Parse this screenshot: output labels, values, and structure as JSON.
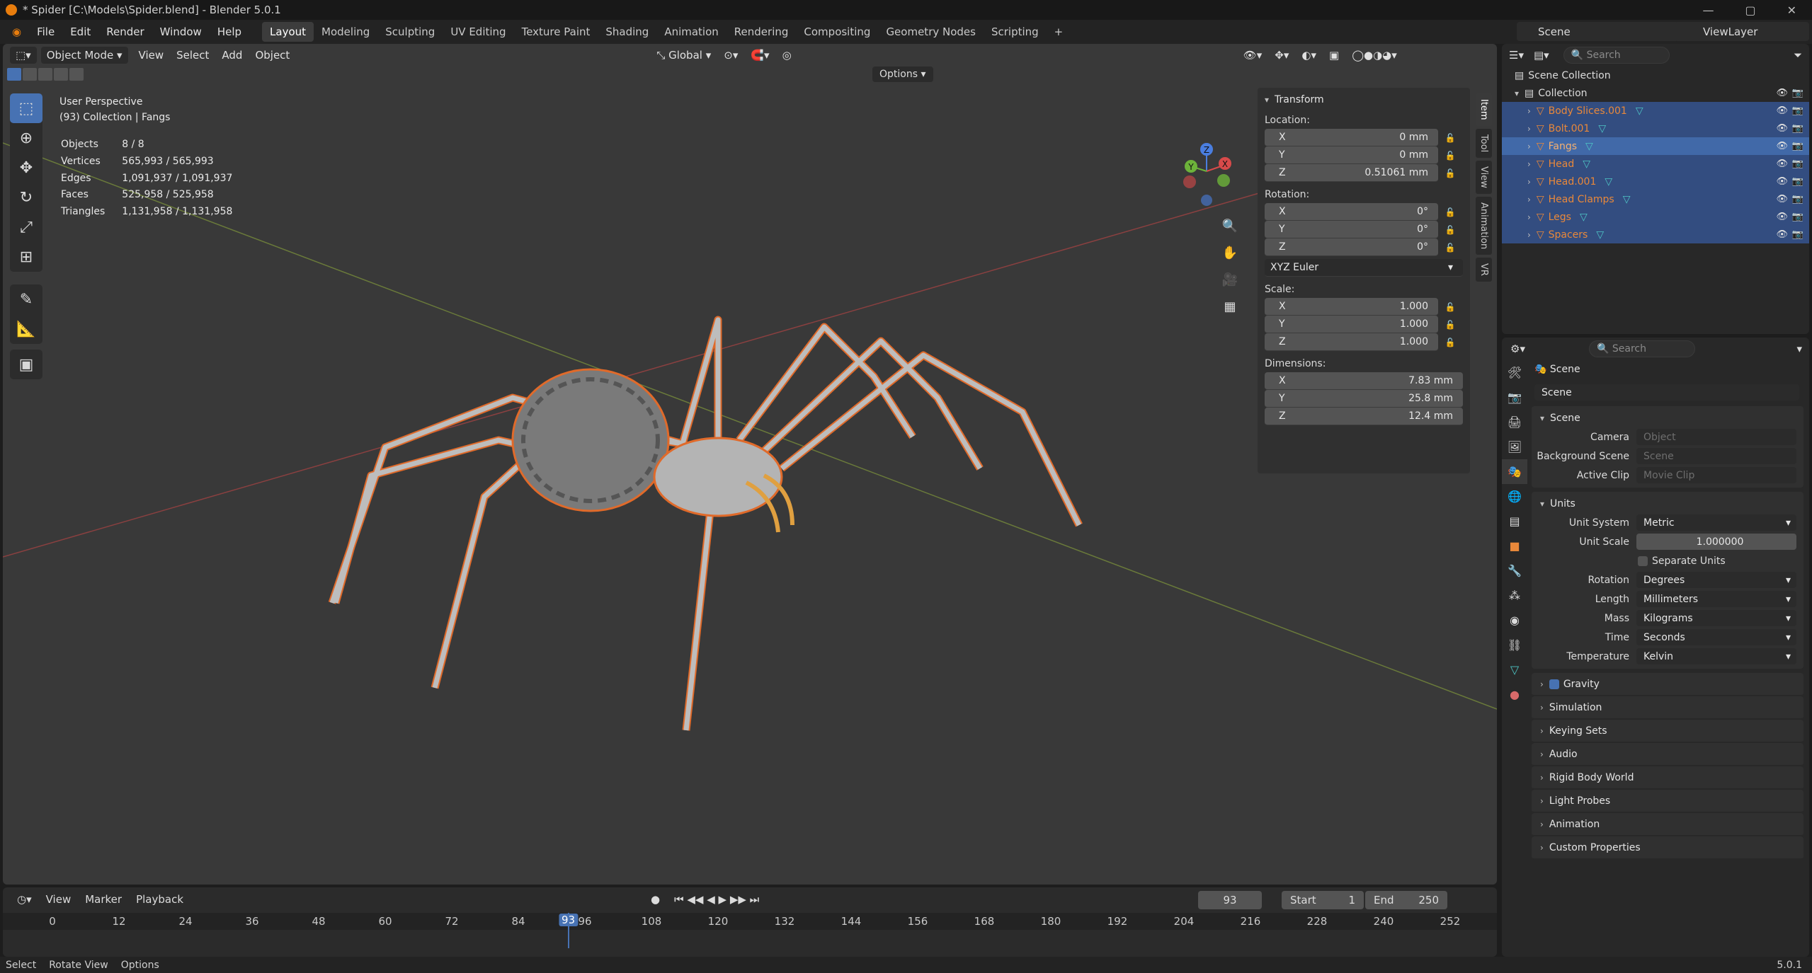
{
  "window": {
    "title": "* Spider [C:\\Models\\Spider.blend] - Blender 5.0.1"
  },
  "menu": [
    "File",
    "Edit",
    "Render",
    "Window",
    "Help"
  ],
  "workspaces": [
    "Layout",
    "Modeling",
    "Sculpting",
    "UV Editing",
    "Texture Paint",
    "Shading",
    "Animation",
    "Rendering",
    "Compositing",
    "Geometry Nodes",
    "Scripting"
  ],
  "active_workspace": "Layout",
  "scene_selector": "Scene",
  "viewlayer_selector": "ViewLayer",
  "viewport": {
    "mode": "Object Mode",
    "menus": [
      "View",
      "Select",
      "Add",
      "Object"
    ],
    "orientation": "Global",
    "options_label": "Options",
    "perspective": "User Perspective",
    "collection_info": "(93) Collection | Fangs",
    "stats": [
      {
        "label": "Objects",
        "value": "8 / 8"
      },
      {
        "label": "Vertices",
        "value": "565,993 / 565,993"
      },
      {
        "label": "Edges",
        "value": "1,091,937 / 1,091,937"
      },
      {
        "label": "Faces",
        "value": "525,958 / 525,958"
      },
      {
        "label": "Triangles",
        "value": "1,131,958 / 1,131,958"
      }
    ],
    "gizmo": {
      "x": "X",
      "y": "Y",
      "z": "Z"
    }
  },
  "transform": {
    "title": "Transform",
    "location_label": "Location:",
    "location": [
      {
        "axis": "X",
        "value": "0 mm"
      },
      {
        "axis": "Y",
        "value": "0 mm"
      },
      {
        "axis": "Z",
        "value": "0.51061 mm"
      }
    ],
    "rotation_label": "Rotation:",
    "rotation": [
      {
        "axis": "X",
        "value": "0°"
      },
      {
        "axis": "Y",
        "value": "0°"
      },
      {
        "axis": "Z",
        "value": "0°"
      }
    ],
    "rotation_mode": "XYZ Euler",
    "scale_label": "Scale:",
    "scale": [
      {
        "axis": "X",
        "value": "1.000"
      },
      {
        "axis": "Y",
        "value": "1.000"
      },
      {
        "axis": "Z",
        "value": "1.000"
      }
    ],
    "dimensions_label": "Dimensions:",
    "dimensions": [
      {
        "axis": "X",
        "value": "7.83 mm"
      },
      {
        "axis": "Y",
        "value": "25.8 mm"
      },
      {
        "axis": "Z",
        "value": "12.4 mm"
      }
    ]
  },
  "sidebar_tabs": [
    "Item",
    "Tool",
    "View",
    "Animation",
    "VR"
  ],
  "timeline": {
    "menus": [
      "View",
      "Marker",
      "Playback"
    ],
    "current_frame": "93",
    "start_label": "Start",
    "start": "1",
    "end_label": "End",
    "end": "250",
    "ticks": [
      "0",
      "12",
      "24",
      "36",
      "48",
      "60",
      "72",
      "84",
      "96",
      "108",
      "120",
      "132",
      "144",
      "156",
      "168",
      "180",
      "192",
      "204",
      "216",
      "228",
      "240",
      "252"
    ],
    "cursor": "93"
  },
  "statusbar": {
    "items": [
      "Select",
      "Rotate View",
      "Options"
    ],
    "version": "5.0.1"
  },
  "outliner": {
    "search_placeholder": "Search",
    "root": "Scene Collection",
    "collection": "Collection",
    "objects": [
      "Body Slices.001",
      "Bolt.001",
      "Fangs",
      "Head",
      "Head.001",
      "Head Clamps",
      "Legs",
      "Spacers"
    ],
    "active": "Fangs"
  },
  "properties": {
    "search_placeholder": "Search",
    "context": "Scene",
    "scene_name": "Scene",
    "scene_panel": "Scene",
    "camera_label": "Camera",
    "camera_placeholder": "Object",
    "bg_scene_label": "Background Scene",
    "bg_scene_placeholder": "Scene",
    "active_clip_label": "Active Clip",
    "active_clip_placeholder": "Movie Clip",
    "units_panel": "Units",
    "units": [
      {
        "label": "Unit System",
        "value": "Metric"
      },
      {
        "label": "Unit Scale",
        "value": "1.000000"
      }
    ],
    "separate_units": "Separate Units",
    "unit_fields": [
      {
        "label": "Rotation",
        "value": "Degrees"
      },
      {
        "label": "Length",
        "value": "Millimeters"
      },
      {
        "label": "Mass",
        "value": "Kilograms"
      },
      {
        "label": "Time",
        "value": "Seconds"
      },
      {
        "label": "Temperature",
        "value": "Kelvin"
      }
    ],
    "collapsed": [
      "Gravity",
      "Simulation",
      "Keying Sets",
      "Audio",
      "Rigid Body World",
      "Light Probes",
      "Animation",
      "Custom Properties"
    ]
  },
  "colors": {
    "accent": "#4772b3",
    "selection": "#e9883a",
    "bg": "#393939"
  }
}
